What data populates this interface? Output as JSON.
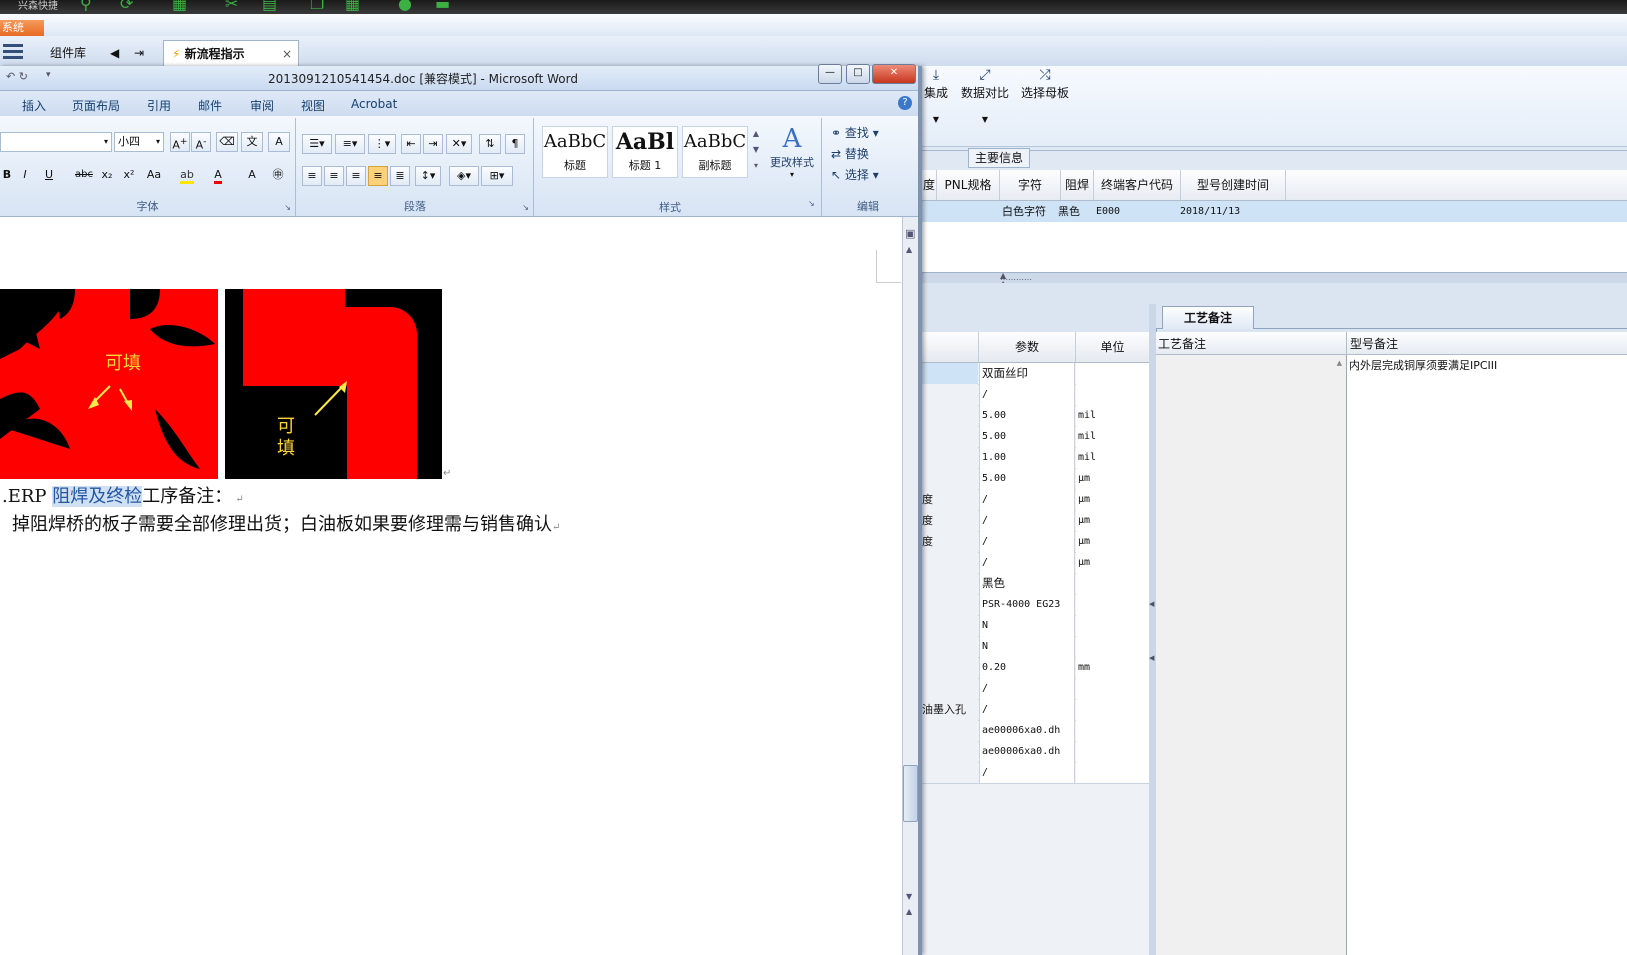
{
  "app": {
    "top_title": "兴森快捷",
    "system_button": "系统",
    "tabs": [
      {
        "label": "组件库"
      },
      {
        "label": "新流程指示",
        "close": "×"
      }
    ],
    "ribbon_buttons": [
      {
        "label": "集成",
        "icon": "import-icon"
      },
      {
        "label": "数据对比",
        "icon": "compare-icon"
      },
      {
        "label": "选择母板",
        "icon": "shuffle-icon"
      }
    ],
    "main_info_label": "主要信息",
    "top_grid": {
      "headers": [
        "度",
        "PNL规格",
        "字符",
        "阻焊",
        "终端客户代码",
        "型号创建时间"
      ],
      "row": [
        "白色字符",
        "黑色",
        "E000",
        "2018/11/13"
      ]
    },
    "param_grid": {
      "headers": [
        "参数",
        "单位"
      ],
      "rows": [
        {
          "name": "",
          "value": "双面丝印",
          "unit": ""
        },
        {
          "name": "",
          "value": "/",
          "unit": ""
        },
        {
          "name": "",
          "value": "5.00",
          "unit": "mil"
        },
        {
          "name": "",
          "value": "5.00",
          "unit": "mil"
        },
        {
          "name": "",
          "value": "1.00",
          "unit": "mil"
        },
        {
          "name": "",
          "value": "5.00",
          "unit": "μm"
        },
        {
          "name": "度",
          "value": "/",
          "unit": "μm"
        },
        {
          "name": "度",
          "value": "/",
          "unit": "μm"
        },
        {
          "name": "度",
          "value": "/",
          "unit": "μm"
        },
        {
          "name": "",
          "value": "/",
          "unit": "μm"
        },
        {
          "name": "",
          "value": "黑色",
          "unit": ""
        },
        {
          "name": "",
          "value": "PSR-4000 EG23",
          "unit": ""
        },
        {
          "name": "",
          "value": "N",
          "unit": ""
        },
        {
          "name": "",
          "value": "N",
          "unit": ""
        },
        {
          "name": "",
          "value": "0.20",
          "unit": "mm"
        },
        {
          "name": "",
          "value": "/",
          "unit": ""
        },
        {
          "name": "油墨入孔",
          "value": "/",
          "unit": ""
        },
        {
          "name": "",
          "value": "ae00006xa0.dh",
          "unit": ""
        },
        {
          "name": "",
          "value": "ae00006xa0.dh",
          "unit": ""
        },
        {
          "name": "",
          "value": "/",
          "unit": ""
        }
      ]
    },
    "notes": {
      "tab": "工艺备注",
      "headers": [
        "工艺备注",
        "型号备注"
      ],
      "model_note": "内外层完成铜厚须要满足IPCIII"
    }
  },
  "word": {
    "title": "2013091210541454.doc [兼容模式] - Microsoft Word",
    "window_buttons": {
      "minimize": "—",
      "restore": "□",
      "close": "✕"
    },
    "tabs": [
      "插入",
      "页面布局",
      "引用",
      "邮件",
      "审阅",
      "视图",
      "Acrobat"
    ],
    "font_size": "小四",
    "groups": [
      "字体",
      "段落",
      "样式",
      "编辑"
    ],
    "styles": [
      {
        "preview": "AaBbC",
        "name": "标题"
      },
      {
        "preview": "AaBl",
        "name": "标题 1"
      },
      {
        "preview": "AaBbC",
        "name": "副标题"
      }
    ],
    "change_styles": "更改样式",
    "edit": [
      "查找",
      "替换",
      "选择"
    ],
    "doc": {
      "img1_label": "可填",
      "img2_label": "可\n填",
      "line1_prefix": ".ERP ",
      "line1_highlight": "阻焊及终检",
      "line1_suffix": "工序备注：",
      "line2": "掉阻焊桥的板子需要全部修理出货；白油板如果要修理需与销售确认"
    }
  },
  "colors": {
    "accent": "#e86a24",
    "selection": "#cfe3f7",
    "red_image": "#ff0000",
    "label_yellow": "#ffd633"
  }
}
